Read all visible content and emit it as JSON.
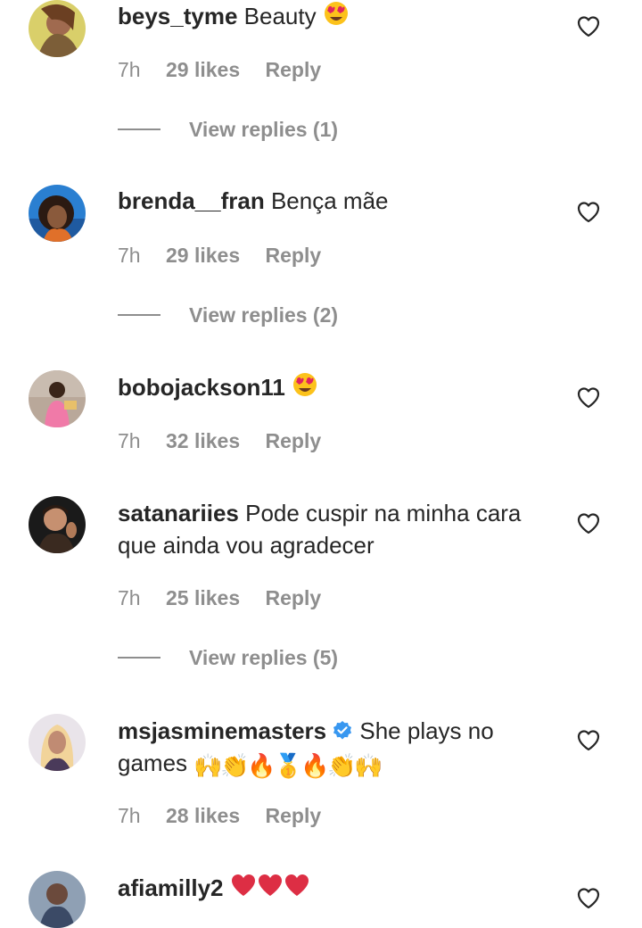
{
  "comments": [
    {
      "username": "beys_tyme",
      "text": "Beauty",
      "emoji_after": [
        "smiling-face-heart-eyes"
      ],
      "time": "7h",
      "likes": "29 likes",
      "reply": "Reply",
      "view_replies": "View replies (1)"
    },
    {
      "username": "brenda__fran",
      "text": "Bença mãe",
      "time": "7h",
      "likes": "29 likes",
      "reply": "Reply",
      "view_replies": "View replies (2)"
    },
    {
      "username": "bobojackson11",
      "text": "",
      "emoji_after": [
        "smiling-face-heart-eyes"
      ],
      "time": "7h",
      "likes": "32 likes",
      "reply": "Reply"
    },
    {
      "username": "satanariies",
      "text": "Pode cuspir na minha cara que ainda vou agradecer",
      "time": "7h",
      "likes": "25 likes",
      "reply": "Reply",
      "view_replies": "View replies (5)"
    },
    {
      "username": "msjasminemasters",
      "verified": true,
      "text": "She plays no games",
      "emoji_after": [
        "raising-hands",
        "clapping-hands",
        "fire",
        "first-place-medal",
        "fire",
        "clapping-hands",
        "raising-hands"
      ],
      "time": "7h",
      "likes": "28 likes",
      "reply": "Reply"
    },
    {
      "username": "afiamilly2",
      "text": "",
      "emoji_after": [
        "red-heart",
        "red-heart",
        "red-heart"
      ]
    }
  ],
  "colors": {
    "primary_text": "#262626",
    "secondary_text": "#8e8e8e",
    "verified_blue": "#3897f0"
  },
  "icons": {
    "like": "heart-outline-icon",
    "verified": "verified-badge-icon"
  }
}
